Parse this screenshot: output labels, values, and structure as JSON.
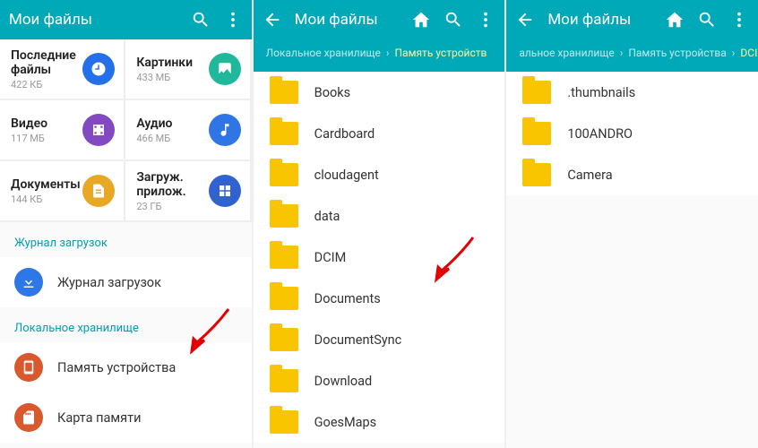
{
  "colors": {
    "appbar": "#00a9b7",
    "accent": "#f9c400",
    "recent": "#2570e8",
    "images": "#20b89a",
    "videos": "#8349c2",
    "audio": "#2f75e6",
    "docs": "#e8a724",
    "apps": "#3063d0",
    "download": "#2f76e6",
    "device": "#d7592d",
    "sd": "#d7592d"
  },
  "p1": {
    "title": "Мои файлы",
    "tiles": [
      {
        "label": "Последние файлы",
        "sub": "422 КБ",
        "color": "recent"
      },
      {
        "label": "Картинки",
        "sub": "433 МБ",
        "color": "images"
      },
      {
        "label": "Видео",
        "sub": "117 МБ",
        "color": "videos"
      },
      {
        "label": "Аудио",
        "sub": "466 МБ",
        "color": "audio"
      },
      {
        "label": "Документы",
        "sub": "144 КБ",
        "color": "docs"
      },
      {
        "label": "Загруж. прилож.",
        "sub": "23 ГБ",
        "color": "apps"
      }
    ],
    "section_downloads": "Журнал загрузок",
    "row_downloads": "Журнал загрузок",
    "section_storage": "Локальное хранилище",
    "row_device": "Память устройства",
    "row_sd": "Карта памяти"
  },
  "p2": {
    "title": "Мои файлы",
    "crumb1": "Локальное хранилище",
    "crumb2": "Память устройств",
    "folders": [
      "Books",
      "Cardboard",
      "cloudagent",
      "data",
      "DCIM",
      "Documents",
      "DocumentSync",
      "Download",
      "GoesMaps"
    ]
  },
  "p3": {
    "title": "Мои файлы",
    "crumb1": "альное хранилище",
    "crumb2": "Память устройства",
    "crumb3": "DCIM",
    "folders": [
      ".thumbnails",
      "100ANDRO",
      "Camera"
    ]
  }
}
